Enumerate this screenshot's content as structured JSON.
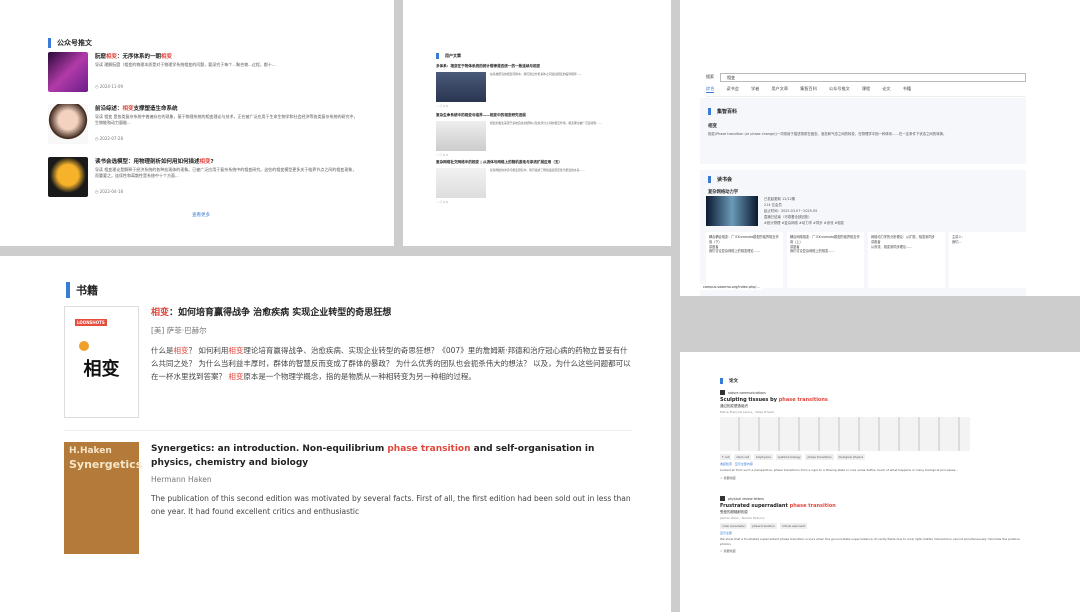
{
  "panelA": {
    "section_title": "公众号推文",
    "articles": [
      {
        "title_before": "朊窟",
        "title_hl": "相变",
        "title_after": "：无序体系的一朝",
        "title_tail": "相变",
        "desc": "导读 理解朊窟（相变的物理本质是对于物理学系统相变的问题，要深究于每个...聚合物...过程，都十...",
        "date": "2024-11-09"
      },
      {
        "title_before": "前沿综述：",
        "title_hl": "相变",
        "title_after": "支撑塑造生命系统",
        "title_tail": "",
        "desc": "导读 相变 是各类复杂系统中普遍存在的现象，基于物理系统的相变理论与技术，正在被广泛应用于生命生物学和社会经济等各类复杂系统的研究中，生物能和动力量能...",
        "date": "2022-07-28"
      },
      {
        "title_before": "读书会选模型：用物理剖析如何用如何描述",
        "title_hl": "相变",
        "title_after": "?",
        "title_tail": "",
        "desc": "导读 相变理论是解释于经济系统的各种宏观体的现象。已被广泛应用于复杂系统中的相变研究。这些的相变模型更多关于临界节点之间的相变现象，而重要之，连续性和离散性是系统中十个方面...",
        "date": "2022-04-18"
      }
    ],
    "more_label": "查看更多"
  },
  "panelB": {
    "section_title": "用户文章",
    "items": [
      {
        "title": "多体系：相变在于物体系统的统计规律是否统一的一致连续与相变",
        "text": "在系统研究的相变问题中，我们通过分析多体之间连接相变的临界规律……",
        "actions": "0  0"
      },
      {
        "title": "复杂生命系统中的相变与临界——相变中的相变研究进展",
        "text": "相变的发生来源于系统自身的结构以及各部分之间的相互作用，相变理论被广泛运用到……",
        "actions": "0  0"
      },
      {
        "title": "复杂网络社交网络中的相变 | 从流体与网络上的随机游走与渗流扩展应用（五）",
        "text": "复杂网络的渗流与相变研究中，我们描述了网络连接稳定性与相变的关系……",
        "actions": "0  0"
      }
    ]
  },
  "panelC": {
    "search_label": "搜索",
    "search_value": "相变",
    "tabs": [
      "综合",
      "读书会",
      "学者",
      "用户文章",
      "集智百科",
      "公众号推文",
      "课程",
      "论文",
      "书籍"
    ],
    "active_tab": "综合",
    "encyclopedia_title": "集智百科",
    "encyclopedia_entry": "相变",
    "encyclopedia_desc": "相变(Phase transition (or phase change))一词常用于描述物质在固态、液态和气态之间的转变，在物理学中指一种体系……在一定条件下状态之间的转换。",
    "reading_title": "读书会",
    "reading_name": "复杂网络动力学",
    "reading_meta": [
      "已发起更新 12/12期",
      "214 位会员",
      "起止时间：2025.03.07~2025.05",
      "直播已结束（可观看全部回放）",
      "#统计物理 #复杂网络 #动力学 #同步 #渗流 #相变"
    ],
    "cards": [
      {
        "title": "耦合耦合相变：广义Kuramoto模型的临界相互作用（下）",
        "author": "讲座者",
        "desc": "我们讨论复杂网络上的相变理论……"
      },
      {
        "title": "耦合网络相变：广义Kuramoto模型的临界相互作用（上）",
        "author": "讲座者",
        "desc": "我们讨论复杂网络上的相变……"
      },
      {
        "title": "网络动力学的分析理论：从扩散、相变到同步",
        "author": "讲座者",
        "desc": "从渗流、相变到同步理论……"
      },
      {
        "title": "主讲人：",
        "author": "",
        "desc": "我们..."
      }
    ],
    "url": "campus.swarma.org/index.php/..."
  },
  "panelD": {
    "section_title": "书籍",
    "books": [
      {
        "title_hl": "相变",
        "title_rest": "：如何培育赢得战争 治愈疾病 实现企业转型的奇思狂想",
        "author": "[美] 萨菲·巴赫尔",
        "desc_parts": [
          "什么是",
          "相变",
          "？ 如何利用",
          "相变",
          "理论培育赢得战争、治愈疾病、实现企业转型的奇思狂想？《007》里的詹姆斯·邦德和治疗冠心病的药物立普妥有什么共同之处？ 为什么当利益丰厚时，群体的智慧反而变成了群体的暴政？ 为什么优秀的团队也会扼杀伟大的想法？ 以及，为什么这些问题都可以在一杯水里找到答案？ ",
          "相变",
          "原本是一个物理学概念，指的是物质从一种相转变为另一种相的过程。"
        ],
        "cover_title": "相变",
        "cover_label": "LOONSHOTS"
      },
      {
        "title_before": "Synergetics: an introduction. Non-equilibrium ",
        "title_hl": "phase transition",
        "title_after": " and self-organisation in physics, chemistry and biology",
        "author": "Hermann Haken",
        "desc": "The publication of this second edition was motivated by several facts. First of all, the first edition had been sold out in less than one year. It had found excellent critics and enthusiastic",
        "cover_title": "Synergetics",
        "cover_label": "H.Haken"
      }
    ]
  },
  "panelE": {
    "section_title": "论文",
    "papers": [
      {
        "journal": "nature communications",
        "title_before": "Sculpting tissues by ",
        "title_hl": "phase transitions",
        "title_cn": "通过相变塑造组织",
        "authors": "Pierre-François Lenne，Vikas Trivedi",
        "tags": [
          "T cell",
          "stem cell",
          "biophysics",
          "systems biology",
          "phase transitions",
          "biological physics"
        ],
        "link": "收起检索 · 显示全部内容",
        "abstract": "Looked at from such a perspective, phase transitions from a rigid to a flowing state or vice versa define much of what happens in many biological processes...",
        "fav": "我要收藏"
      },
      {
        "journal": "physical review letters",
        "title_before": "Frustrated superradiant ",
        "title_hl": "phase transition",
        "title_cn": "受挫的超辐射相变",
        "authors": "Jianhui Zhao，Nicolai Fedorov",
        "tags": [
          "order parameter",
          "phase transition",
          "critical exponent"
        ],
        "link": "显示全部",
        "abstract": "We show that a frustrated superradiant phase transition occurs when the ground-state superradiance of cavity fields due to local light-matter interactions cannot simultaneously minimize the positive photon.",
        "fav": "我要收藏"
      }
    ]
  }
}
